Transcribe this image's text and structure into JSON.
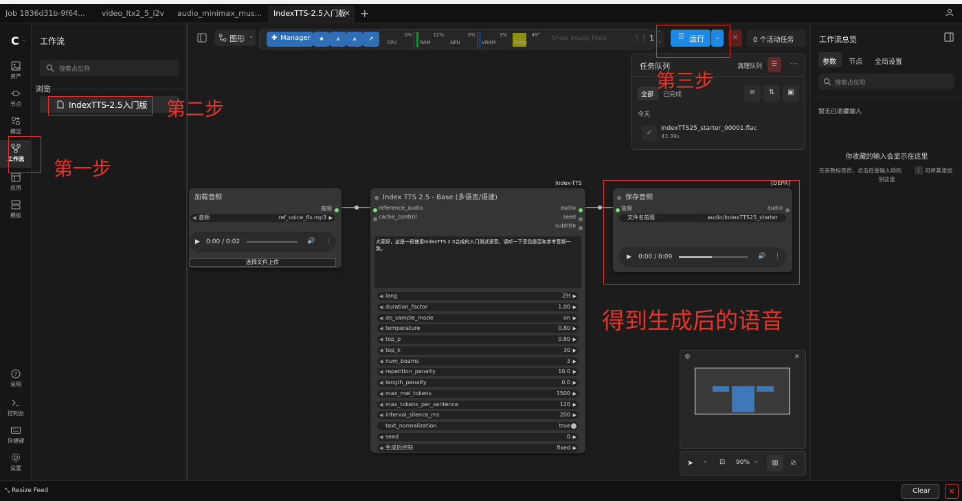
{
  "tabs": [
    {
      "label": "Job 1836d31b-9f64...",
      "active": false
    },
    {
      "label": "video_ltx2_5_i2v",
      "active": false
    },
    {
      "label": "audio_minimax_mus...",
      "active": false
    },
    {
      "label": "IndexTTS-2.5入门版",
      "active": true
    }
  ],
  "rail": [
    {
      "label": "资产",
      "icon": "image-icon"
    },
    {
      "label": "节点",
      "icon": "plug-icon"
    },
    {
      "label": "模型",
      "icon": "cube-icon"
    },
    {
      "label": "工作流",
      "icon": "workflow-icon"
    },
    {
      "label": "应用",
      "icon": "app-icon"
    },
    {
      "label": "模板",
      "icon": "template-icon"
    },
    {
      "label": "说明",
      "icon": "help-icon"
    },
    {
      "label": "控制台",
      "icon": "terminal-icon"
    },
    {
      "label": "快捷键",
      "icon": "keyboard-icon"
    },
    {
      "label": "设置",
      "icon": "gear-icon"
    }
  ],
  "left_panel": {
    "title": "工作流",
    "search_placeholder": "搜索占位符",
    "browse_label": "浏览",
    "workflow_item": "IndexTTS-2.5入门版"
  },
  "toolbar": {
    "view_label": "图形",
    "manager_label": "Manager",
    "meters": [
      {
        "name": "CPU",
        "value": "0%"
      },
      {
        "name": "RAM",
        "value": "12%"
      },
      {
        "name": "GPU",
        "value": "0%"
      },
      {
        "name": "VRAM",
        "value": "3%"
      },
      {
        "name": "Temp",
        "value": "49°"
      }
    ],
    "show_image_feed": "Show Image Feed",
    "batch_count": "1",
    "run_label": "运行",
    "active_tasks": "0 个活动任务"
  },
  "queue": {
    "title": "任务队列",
    "clear_label": "清理队列",
    "filter_all": "全部",
    "filter_done": "已完成",
    "today_label": "今天",
    "item_name": "IndexTTS25_starter_00001.flac",
    "item_time": "43.39s"
  },
  "nodes": {
    "load_audio": {
      "title": "加载音频",
      "output_label": "音频",
      "widget_label": "音频",
      "widget_value": "ref_voice_6s.mp3",
      "player_time": "0:00 / 0:02",
      "upload_label": "选择文件上传"
    },
    "index_tts": {
      "group_label": "Index-TTS",
      "title": "Index TTS 2.5 - Base (多语言/语速)",
      "inputs": [
        "reference_audio",
        "cache_control"
      ],
      "outputs": [
        "audio",
        "seed",
        "subtitle"
      ],
      "text": "大家好，这是一段使用IndexTTS 2.5合成的入门测试语音。请听一下音色是否和参考音频一致。",
      "widgets": [
        {
          "label": "lang",
          "value": "ZH"
        },
        {
          "label": "duration_factor",
          "value": "1.00"
        },
        {
          "label": "do_sample_mode",
          "value": "on"
        },
        {
          "label": "temperature",
          "value": "0.80"
        },
        {
          "label": "top_p",
          "value": "0.80"
        },
        {
          "label": "top_k",
          "value": "30"
        },
        {
          "label": "num_beams",
          "value": "3"
        },
        {
          "label": "repetition_penalty",
          "value": "10.0"
        },
        {
          "label": "length_penalty",
          "value": "0.0"
        },
        {
          "label": "max_mel_tokens",
          "value": "1500"
        },
        {
          "label": "max_tokens_per_sentence",
          "value": "120"
        },
        {
          "label": "interval_silence_ms",
          "value": "200"
        },
        {
          "label": "text_normalization",
          "value": "true"
        },
        {
          "label": "seed",
          "value": "0"
        },
        {
          "label": "生成后控制",
          "value": "fixed"
        }
      ]
    },
    "save_audio": {
      "tag": "[DEPR]",
      "title": "保存音频",
      "input_label": "音频",
      "output_label": "audio",
      "widget_label": "文件名前缀",
      "widget_value": "audio/IndexTTS25_starter",
      "player_time": "0:00 / 0:09"
    }
  },
  "annotations": {
    "step1": "第一步",
    "step2": "第二步",
    "step3": "第三步",
    "result": "得到生成后的语音"
  },
  "minimap": {
    "zoom": "90%"
  },
  "right_panel": {
    "title": "工作流总览",
    "tabs": [
      "参数",
      "节点",
      "全局设置"
    ],
    "search_placeholder": "搜索占位符",
    "empty_title": "暂无已收藏输入",
    "empty_hint": "你收藏的输入会显示在这里",
    "empty_desc1": "在参数标签页，点击任意输入项的",
    "empty_desc2": "可将其添加",
    "empty_desc3": "到这里"
  },
  "bottom": {
    "resize_feed": "Resize Feed",
    "clear": "Clear"
  },
  "colors": {
    "accent": "#1e88e5",
    "annotation": "#e3352a",
    "link_green": "#7be07b"
  }
}
